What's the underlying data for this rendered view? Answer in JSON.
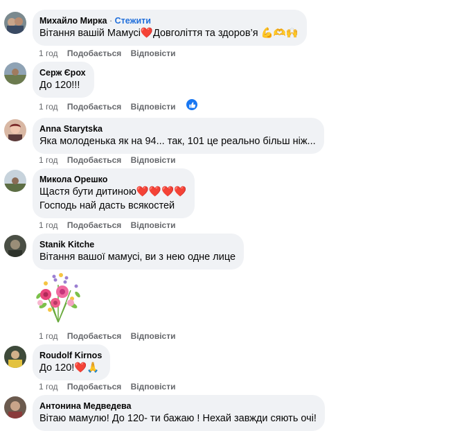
{
  "actions": {
    "like_label": "Подобається",
    "reply_label": "Відповісти"
  },
  "comments": [
    {
      "author": "Михайло Мирка",
      "follow_label": "Стежити",
      "text": "Вітання вашій Мамусі❤️Довголіття та здоров’я 💪🫶🙌",
      "time": "1 год"
    },
    {
      "author": "Серж Єрох",
      "text": "До 120!!!",
      "time": "1 год",
      "reactions": "like-icon"
    },
    {
      "author": "Anna Starytska",
      "text": "Яка молоденька як на 94... так, 101 це реально більш ніж...",
      "time": "1 год"
    },
    {
      "author": "Микола Орешко",
      "text_lines": [
        "Щастя бути дитиною❤️❤️❤️❤️",
        "Господь най дасть всякостей"
      ],
      "time": "1 год"
    },
    {
      "author": "Stanik Kitche",
      "text": "Вітання вашої мамусі, ви з нею одне лице",
      "time": "1 год",
      "sticker": "flower-bouquet-sticker"
    },
    {
      "author": "Roudolf Kirnos",
      "text": "До 120!❤️🙏",
      "time": "1 год"
    },
    {
      "author": "Антонина Медведева",
      "text": "Вітаю мамулю! До 120- ти бажаю ! Нехай завжди сяють очі!"
    }
  ],
  "colors": {
    "bubble_bg": "#f0f2f5",
    "link_blue": "#216fdb",
    "meta_gray": "#65676b",
    "like_blue": "#1877f2"
  }
}
